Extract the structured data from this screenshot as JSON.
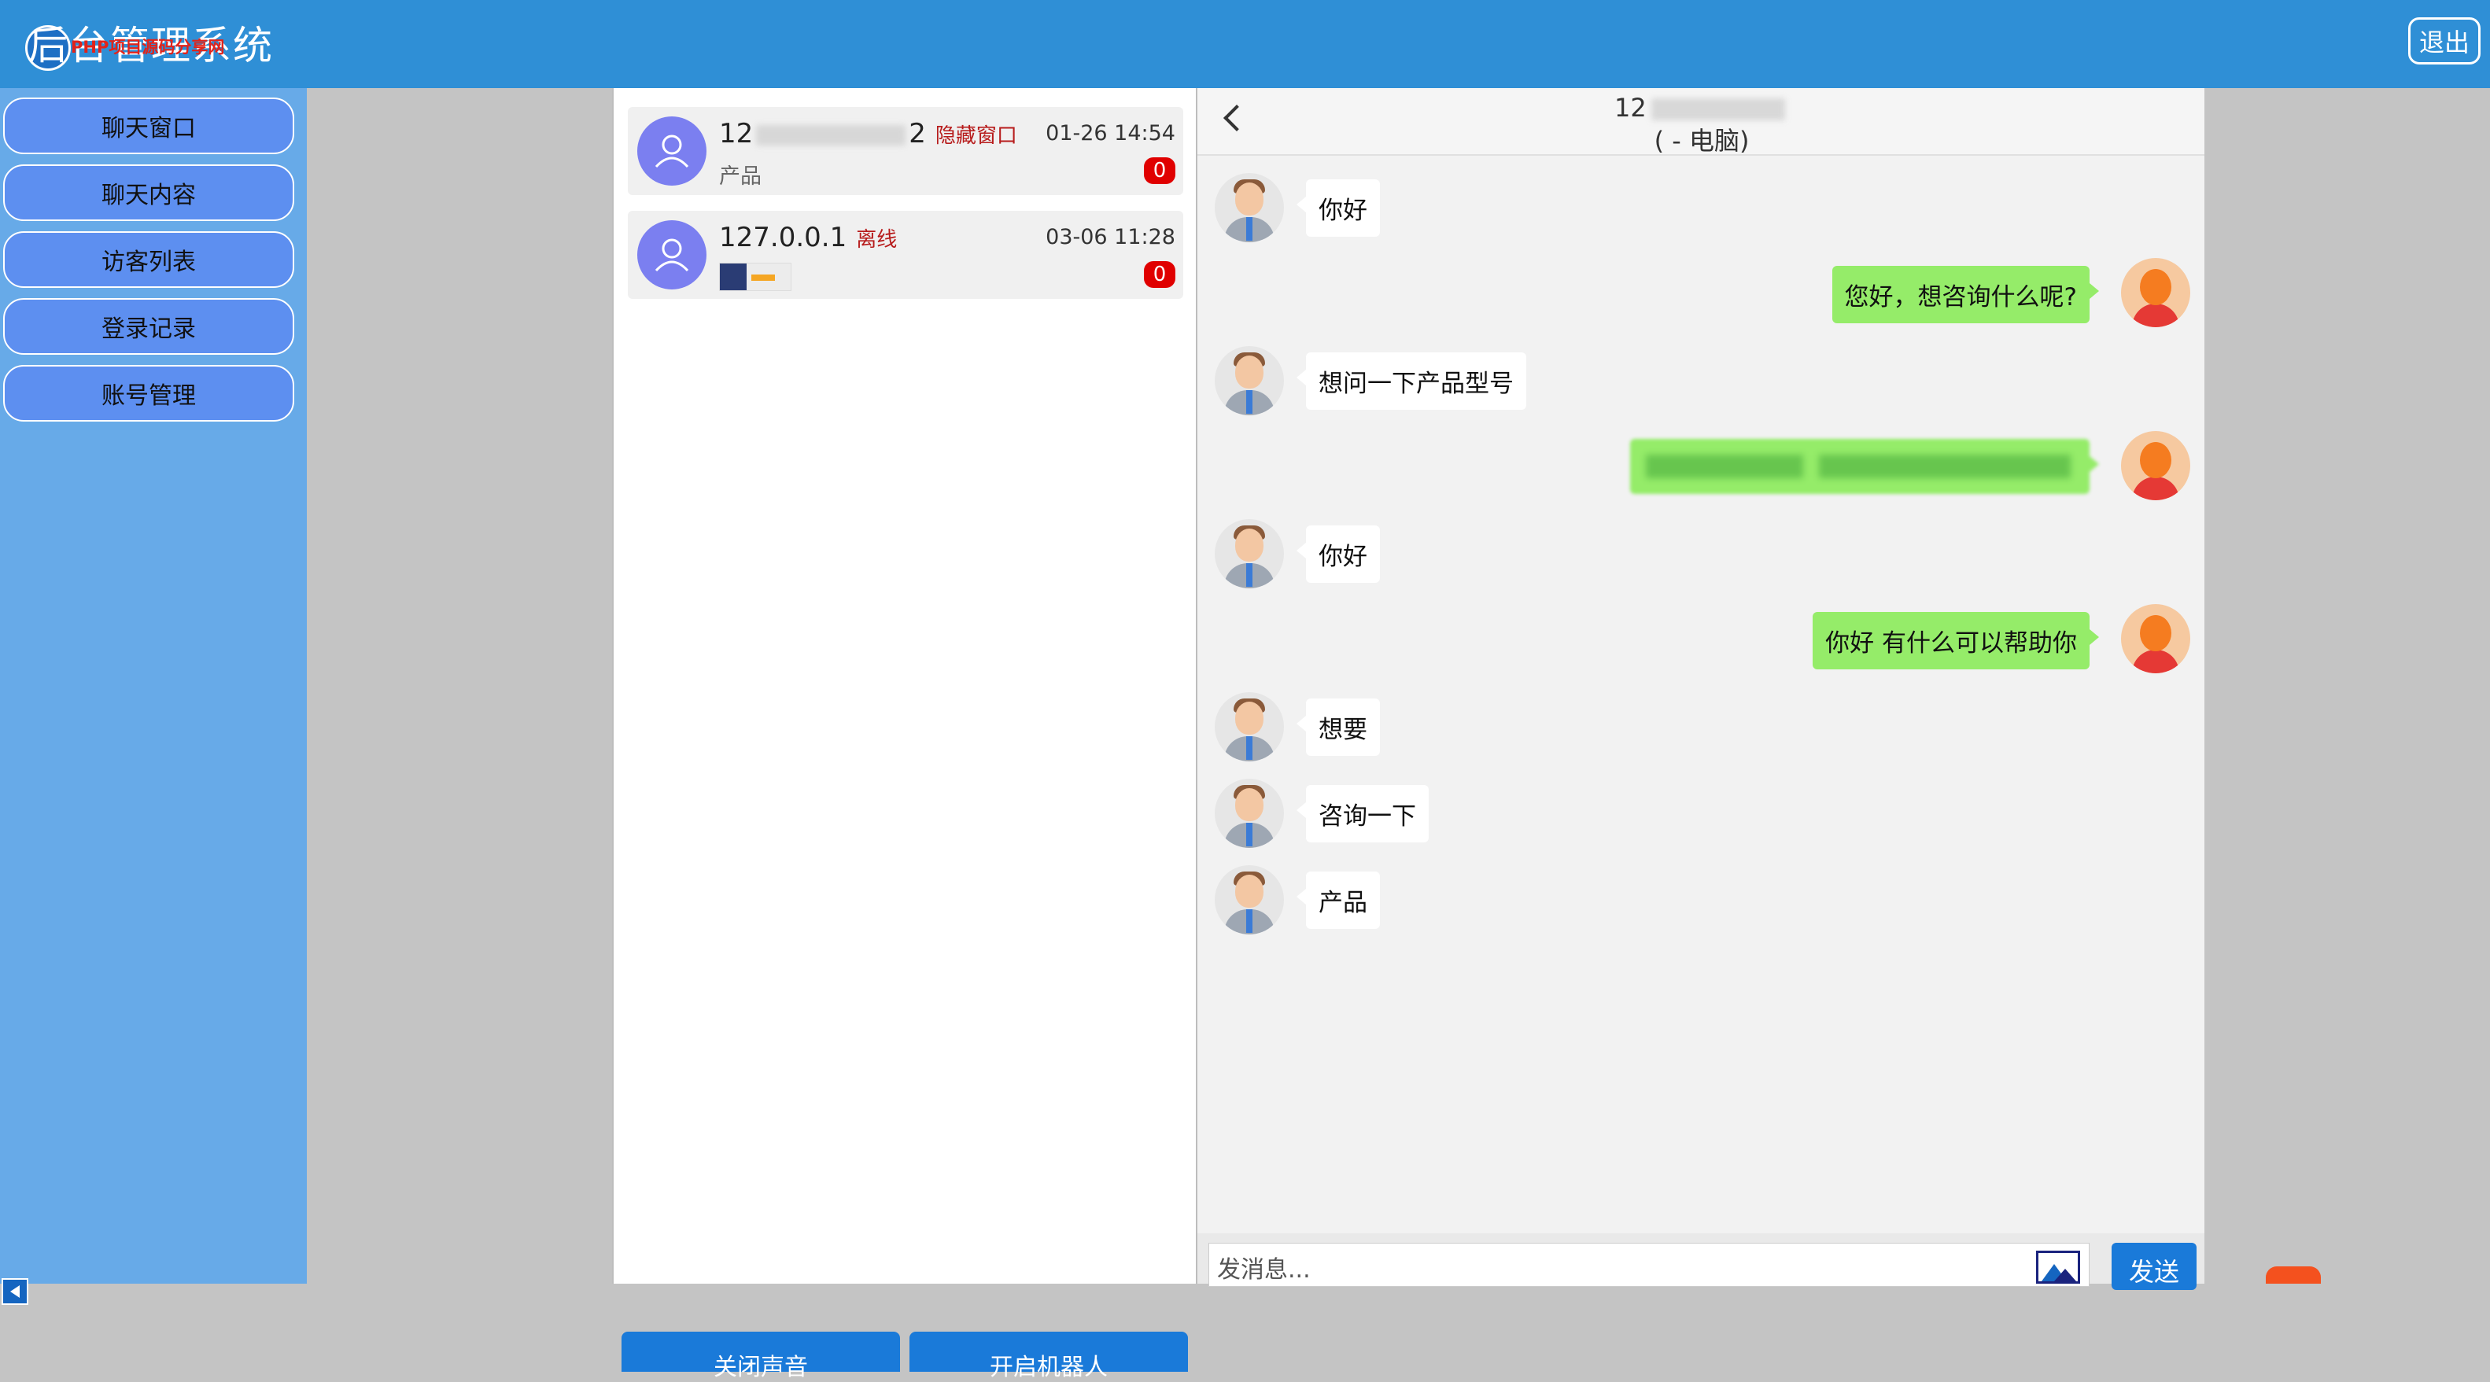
{
  "header": {
    "title": "后台管理系统",
    "logo_text": "PHP项目源码分享网",
    "logout_label": "退出"
  },
  "sidebar": {
    "items": [
      {
        "label": "聊天窗口"
      },
      {
        "label": "聊天内容"
      },
      {
        "label": "访客列表"
      },
      {
        "label": "登录记录"
      },
      {
        "label": "账号管理"
      }
    ]
  },
  "visitors": [
    {
      "name": "12",
      "name_suffix": "2",
      "status": "隐藏窗口",
      "time": "01-26 14:54",
      "preview": "产品",
      "unread": "0"
    },
    {
      "name": "127.0.0.1",
      "status": "离线",
      "time": "03-06 11:28",
      "preview": "",
      "unread": "0"
    }
  ],
  "panel_buttons": {
    "mute_label": "关闭声音",
    "robot_label": "开启机器人"
  },
  "chat": {
    "title_ip": "12",
    "title_device": "( - 电脑)",
    "messages": [
      {
        "side": "visitor",
        "text": "你好"
      },
      {
        "side": "agent",
        "text": "您好，想咨询什么呢?"
      },
      {
        "side": "visitor",
        "text": "想问一下产品型号"
      },
      {
        "side": "agent",
        "text": ""
      },
      {
        "side": "visitor",
        "text": "你好"
      },
      {
        "side": "agent",
        "text": "你好 有什么可以帮助你"
      },
      {
        "side": "visitor",
        "text": "想要"
      },
      {
        "side": "visitor",
        "text": "咨询一下"
      },
      {
        "side": "visitor",
        "text": "产品"
      }
    ],
    "input_placeholder": "发消息...",
    "send_label": "发送"
  },
  "colors": {
    "header_bg": "#2f8fd6",
    "sidebar_bg": "#67aae8",
    "nav_button_bg": "#5d8ff0",
    "agent_bubble": "#95ec69",
    "badge_red": "#e00000",
    "action_blue": "#1a7ad9"
  },
  "icons": [
    "back-icon",
    "user-avatar-icon",
    "image-upload-icon",
    "collapse-sidebar-icon"
  ]
}
